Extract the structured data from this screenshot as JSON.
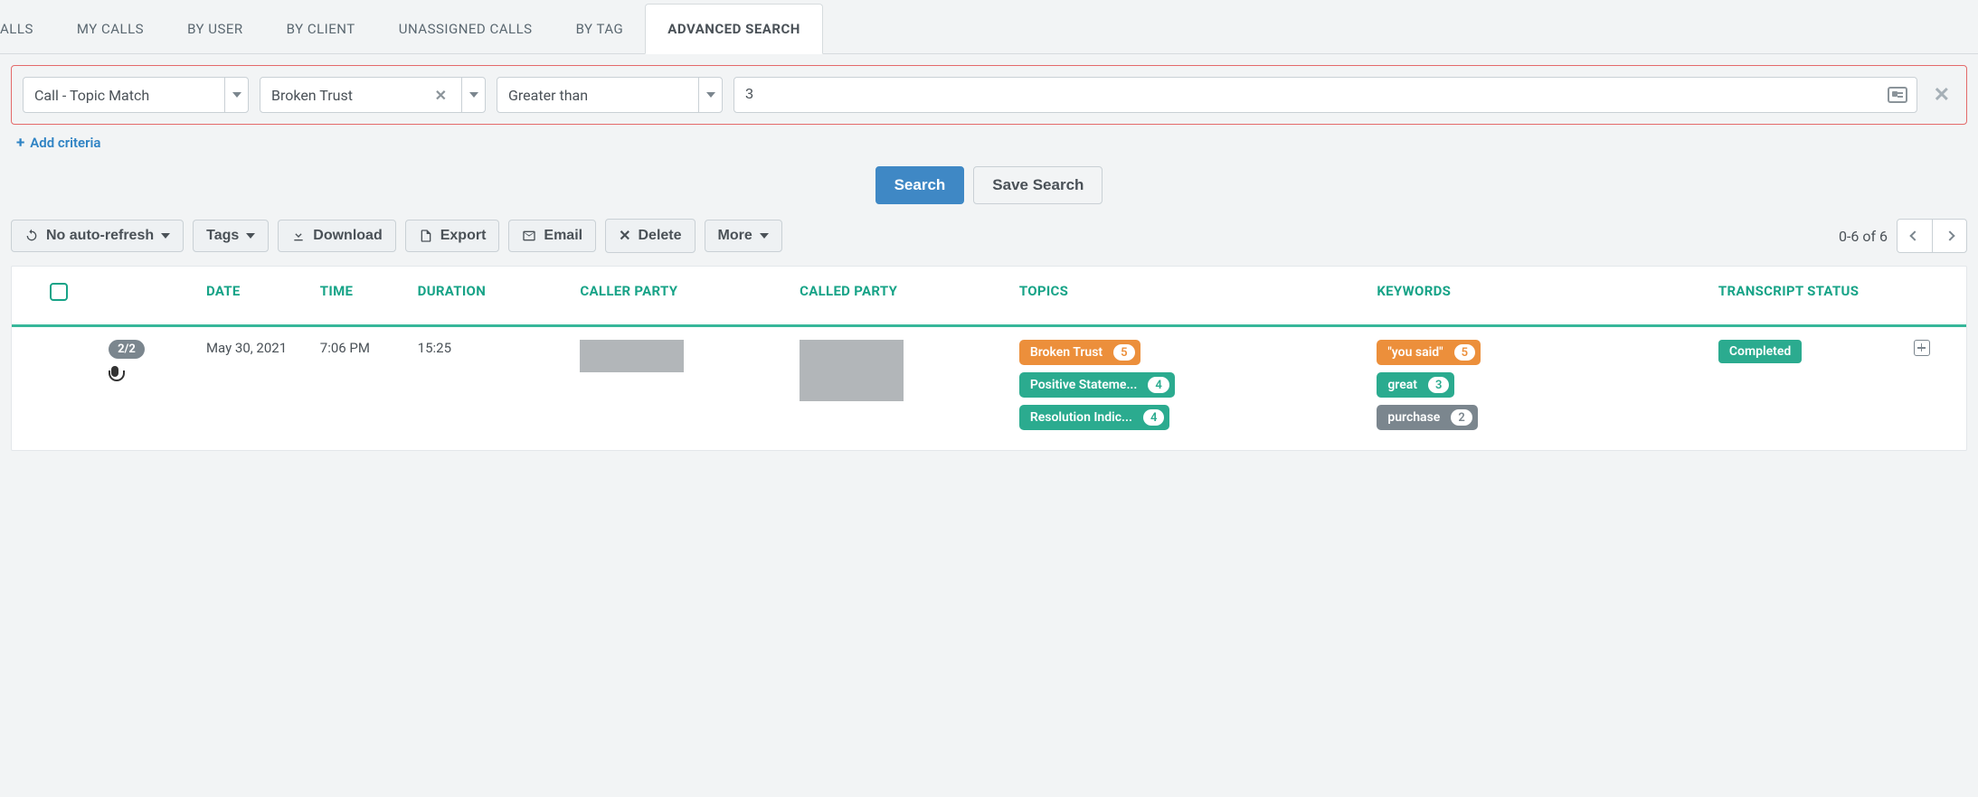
{
  "tabs": [
    {
      "label": "ALLS"
    },
    {
      "label": "MY CALLS"
    },
    {
      "label": "BY USER"
    },
    {
      "label": "BY CLIENT"
    },
    {
      "label": "UNASSIGNED CALLS"
    },
    {
      "label": "BY TAG"
    },
    {
      "label": "ADVANCED SEARCH",
      "active": true
    }
  ],
  "criteria": {
    "field": "Call - Topic Match",
    "topic": "Broken Trust",
    "operator": "Greater than",
    "value": "3"
  },
  "add_criteria_label": "Add criteria",
  "buttons": {
    "search": "Search",
    "save_search": "Save Search"
  },
  "toolbar": {
    "refresh": "No auto-refresh",
    "tags": "Tags",
    "download": "Download",
    "export": "Export",
    "email": "Email",
    "delete": "Delete",
    "more": "More"
  },
  "range_text": "0-6 of 6",
  "columns": {
    "date": "DATE",
    "time": "TIME",
    "duration": "DURATION",
    "caller": "CALLER PARTY",
    "called": "CALLED PARTY",
    "topics": "TOPICS",
    "keywords": "KEYWORDS",
    "transcript": "TRANSCRIPT STATUS"
  },
  "row": {
    "badge": "2/2",
    "date": "May 30, 2021",
    "time": "7:06 PM",
    "duration": "15:25",
    "topics": [
      {
        "label": "Broken Trust",
        "count": "5",
        "cls": "orange"
      },
      {
        "label": "Positive Stateme...",
        "count": "4",
        "cls": "teal"
      },
      {
        "label": "Resolution Indic...",
        "count": "4",
        "cls": "teal"
      }
    ],
    "keywords": [
      {
        "label": "\"you said\"",
        "count": "5",
        "cls": "orange"
      },
      {
        "label": "great",
        "count": "3",
        "cls": "teal"
      },
      {
        "label": "purchase",
        "count": "2",
        "cls": "gray"
      }
    ],
    "status": "Completed"
  }
}
